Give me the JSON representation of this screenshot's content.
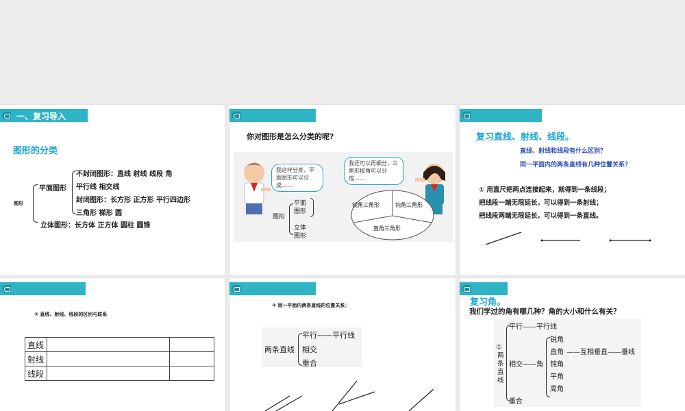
{
  "slide1": {
    "banner": "一、复习导入",
    "heading": "图形的分类",
    "root_label": "图形",
    "plane_label": "平面图形",
    "lines": [
      "不封闭图形：直线 射线 线段 角",
      "平行线 相交线",
      "封闭图形：长方形 正方形 平行四边形",
      "三角形 梯形  圆",
      "立体图形：长方体 正方体 圆柱  圆锥"
    ]
  },
  "slide2": {
    "title": "你对图形是怎么分类的呢?",
    "bubble_left": "我这样分类，平面图形可以分成……",
    "bubble_right": "我还可以再细分，三角形按角可以分成……",
    "tree_root": "图形",
    "tree_plane": "平面图形",
    "tree_solid": "立体图形",
    "pie": [
      "锐角三角形",
      "钝角三角形",
      "直角三角形"
    ]
  },
  "slide3": {
    "heading": "复习直线、射线、线段。",
    "questions": [
      "直线、射线和线段有什么区别？",
      "同一平面内的两条直线有几种位置关系？"
    ],
    "statements": [
      "① 用直尺把两点连接起来，就得到一条线段；",
      "把线段一端无限延长，可以得到一条射线；",
      "把线段两端无限延长，可以得到一条直线。"
    ]
  },
  "slide4": {
    "subtitle": "② 直线、射线、线段的区别与联系",
    "rows": [
      "直线",
      "射线",
      "线段"
    ]
  },
  "slide5": {
    "subtitle": "③ 同一平面内两条直线的位置关系：",
    "root": "两条直线",
    "branches": [
      "平行——平行线",
      "相交",
      "重合"
    ]
  },
  "slide6": {
    "heading": "复习角。",
    "question": "我们学过的角有哪几种？角的大小和什么有关？",
    "circled": "①",
    "root_vertical": "两条直线",
    "parallel": "平行——平行线",
    "intersect": "相交——角",
    "coincide": "重合",
    "angles": [
      "锐角",
      "直角",
      "钝角",
      "平角",
      "周角"
    ],
    "perp": "——互相垂直——垂线"
  },
  "colors": {
    "banner": "#2fb4c6",
    "heading": "#1aa6d6",
    "question": "#2e4fb5"
  }
}
